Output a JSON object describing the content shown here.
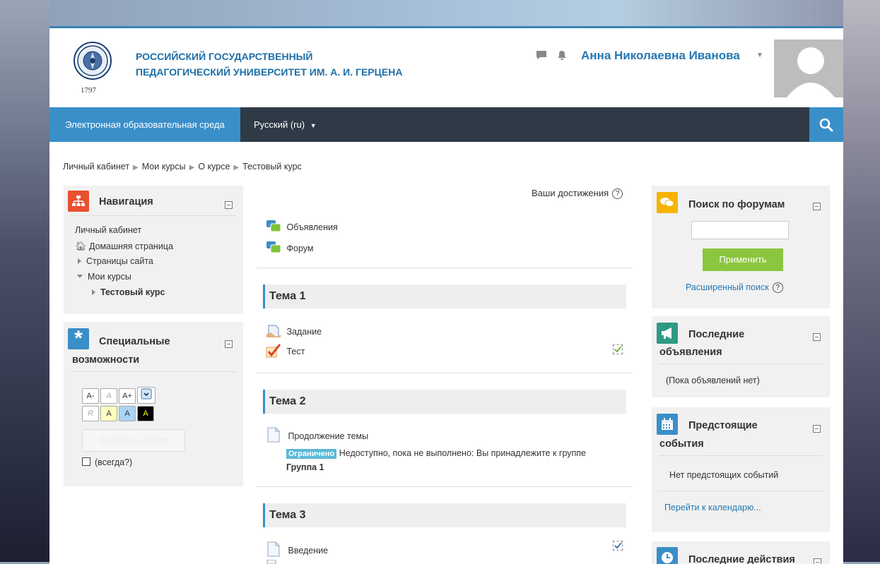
{
  "header": {
    "university_line1": "РОССИЙСКИЙ ГОСУДАРСТВЕННЫЙ",
    "university_line2": "ПЕДАГОГИЧЕСКИЙ УНИВЕРСИТЕТ ИМ. А. И. ГЕРЦЕНА",
    "logo_year": "1797",
    "user_name": "Анна Николаевна Иванова",
    "icons": [
      "chat-icon",
      "bell-icon"
    ]
  },
  "navbar": {
    "home": "Электронная образовательная среда",
    "language": "Русский (ru)",
    "search_icon": "search-icon"
  },
  "breadcrumb": [
    "Личный кабинет",
    "Мои курсы",
    "О курсе",
    "Тестовый курс"
  ],
  "navigation_block": {
    "title": "Навигация",
    "items": {
      "dashboard": "Личный кабинет",
      "home": "Домашняя страница",
      "site_pages": "Страницы сайта",
      "my_courses": "Мои курсы",
      "test_course": "Тестовый курс"
    }
  },
  "accessibility_block": {
    "title_line1": "Специальные",
    "title_line2": "возможности",
    "buttons_row1": [
      "A-",
      "A",
      "A+"
    ],
    "buttons_row2": [
      "R",
      "A",
      "A",
      "A"
    ],
    "launch_button": "Запустить ATbar",
    "always_label": "(всегда?)"
  },
  "course": {
    "achievements": "Ваши достижения",
    "top_activities": [
      "Объявления",
      "Форум"
    ],
    "sections": [
      {
        "title": "Тема 1",
        "activities": [
          "Задание",
          "Тест"
        ]
      },
      {
        "title": "Тема 2",
        "activities": [
          "Продолжение темы"
        ],
        "restriction_badge": "Ограничено",
        "restriction_text": "Недоступно, пока не выполнено: Вы принадлежите к группе",
        "restriction_group": "Группа 1"
      },
      {
        "title": "Тема 3",
        "activities": [
          "Введение"
        ]
      }
    ]
  },
  "forum_search_block": {
    "title": "Поиск по форумам",
    "input_placeholder": "",
    "apply_button": "Применить",
    "advanced_search": "Расширенный поиск"
  },
  "news_block": {
    "title_line1": "Последние",
    "title_line2": "объявления",
    "empty_text": "(Пока объявлений нет)"
  },
  "events_block": {
    "title_line1": "Предстоящие",
    "title_line2": "события",
    "empty_text": "Нет предстоящих событий",
    "calendar_link": "Перейти к календарю..."
  },
  "recent_block": {
    "title": "Последние действия"
  },
  "colors": {
    "accent_blue": "#3a8fc9",
    "navbar_dark": "#2f3a47",
    "apply_green": "#8cc63f",
    "restriction_badge": "#5bb9d8"
  }
}
